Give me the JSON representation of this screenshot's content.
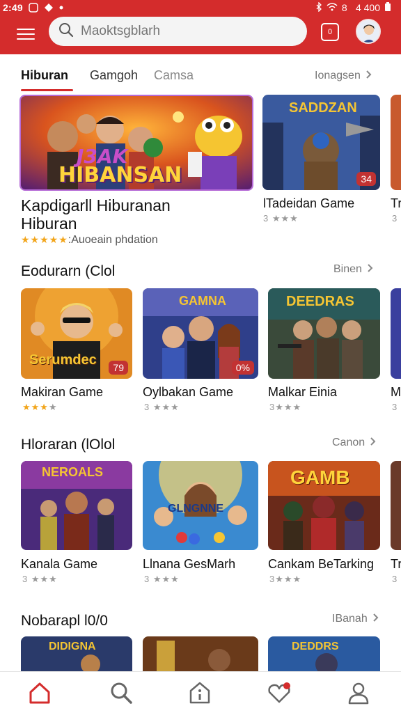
{
  "status": {
    "time": "2:49",
    "right": "8    4 400"
  },
  "search": {
    "placeholder": "Maoktsgblarh"
  },
  "notif_badge": "0",
  "tabs": [
    {
      "label": "Hiburan"
    },
    {
      "label": "Gamgoh"
    },
    {
      "label": "Camsa"
    }
  ],
  "tabs_more": "Ionagsen",
  "featured": {
    "image_text_top": "J3AK",
    "image_text_main": "HIBANSAN",
    "title": "Kapdigarll Hiburanan Hiburan",
    "rating_label": ":Auoeain phdation",
    "side": [
      {
        "image_text": "SADDZAN",
        "badge": "34",
        "title": "lTadeidan Game",
        "rating": "3"
      },
      {
        "title": "Tr",
        "rating": "3"
      }
    ]
  },
  "sections": [
    {
      "title": "Eodurarn (Clol",
      "more": "Binen",
      "items": [
        {
          "image_text": "Serumdec",
          "badge": "79",
          "title": "Makiran Game",
          "rating": "gold"
        },
        {
          "image_text": "GAMNA",
          "badge": "0%",
          "title": "Oylbakan Game",
          "rating": "3"
        },
        {
          "image_text": "DEEDRAS",
          "title": "Malkar Einia",
          "rating": "3"
        },
        {
          "title": "M",
          "rating": "3"
        }
      ]
    },
    {
      "title": "Hloraran (lOlol",
      "more": "Canon",
      "items": [
        {
          "image_text": "NEROALS",
          "title": "Kanala Game",
          "rating": "3"
        },
        {
          "image_text": "GLNGNNE",
          "title": "Llnana GesMarh",
          "rating": "3"
        },
        {
          "image_text": "GAMB",
          "title": "Cankam BeTarking",
          "rating": "3"
        },
        {
          "title": "Tr",
          "rating": "3"
        }
      ]
    },
    {
      "title": "Nobarapl l0/0",
      "more": "IBanah",
      "items": [
        {
          "image_text": "DIDIGNA"
        },
        {
          "image_text": ""
        },
        {
          "image_text": "DEDDRS"
        }
      ]
    }
  ],
  "nav": [
    {
      "icon": "home-icon"
    },
    {
      "icon": "search-icon"
    },
    {
      "icon": "info-icon"
    },
    {
      "icon": "heart-icon"
    },
    {
      "icon": "profile-icon"
    }
  ],
  "colors": {
    "accent": "#d42c2c",
    "star": "#f2a51a"
  }
}
